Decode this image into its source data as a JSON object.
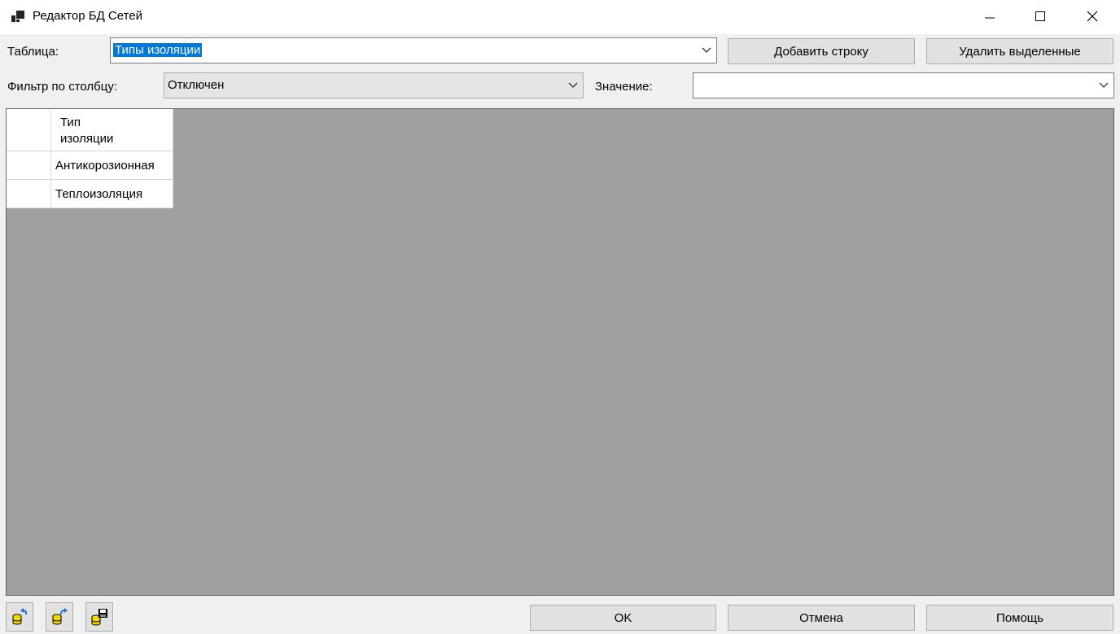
{
  "window": {
    "title": "Редактор БД Сетей",
    "app_icon": "app-window-icon",
    "controls": {
      "minimize": "minimize-icon",
      "maximize": "maximize-icon",
      "close": "close-icon"
    }
  },
  "toolbar": {
    "table_label": "Таблица:",
    "table_value": "Типы изоляции",
    "add_row_label": "Добавить строку",
    "delete_selected_label": "Удалить выделенные",
    "filter_label": "Фильтр по столбцу:",
    "filter_value": "Отключен",
    "value_label": "Значение:",
    "value_value": ""
  },
  "grid": {
    "columns": [
      {
        "header_lines": [
          "Тип",
          "изоляции"
        ]
      }
    ],
    "rows": [
      {
        "cells": [
          "Антикорозионная"
        ]
      },
      {
        "cells": [
          "Теплоизоляция"
        ]
      }
    ]
  },
  "footer": {
    "tools": [
      {
        "icon": "db-undo-icon"
      },
      {
        "icon": "db-redo-icon"
      },
      {
        "icon": "db-save-icon"
      }
    ],
    "ok_label": "OK",
    "cancel_label": "Отмена",
    "help_label": "Помощь"
  },
  "colors": {
    "selection": "#0078d7",
    "grid_background": "#a0a0a0",
    "button_face": "#e1e1e1"
  }
}
